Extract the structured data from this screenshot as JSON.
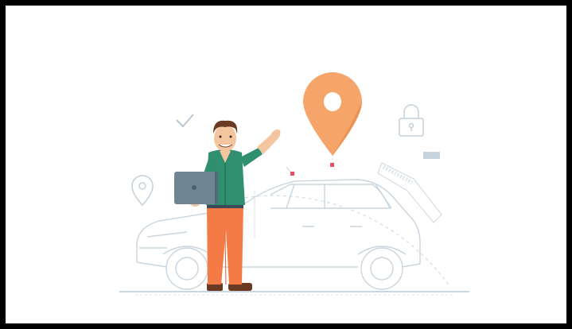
{
  "scene": {
    "subject": "illustration",
    "icons": [
      "location-pin-icon",
      "lock-icon",
      "checkmark-icon",
      "small-pin-icon",
      "laptop-icon",
      "card-icon"
    ],
    "colors": {
      "background": "#ffffff",
      "frame": "#000000",
      "line_art": "#c9d5df",
      "pin_orange": "#f5a46a",
      "pin_orange_dark": "#e98a4a",
      "shirt_green": "#2f8f6f",
      "pants_orange": "#f47b45",
      "laptop_gray": "#6f8594",
      "hair_brown": "#6a3b22",
      "skin": "#f3c6a0",
      "accent_red": "#e8506a"
    }
  }
}
